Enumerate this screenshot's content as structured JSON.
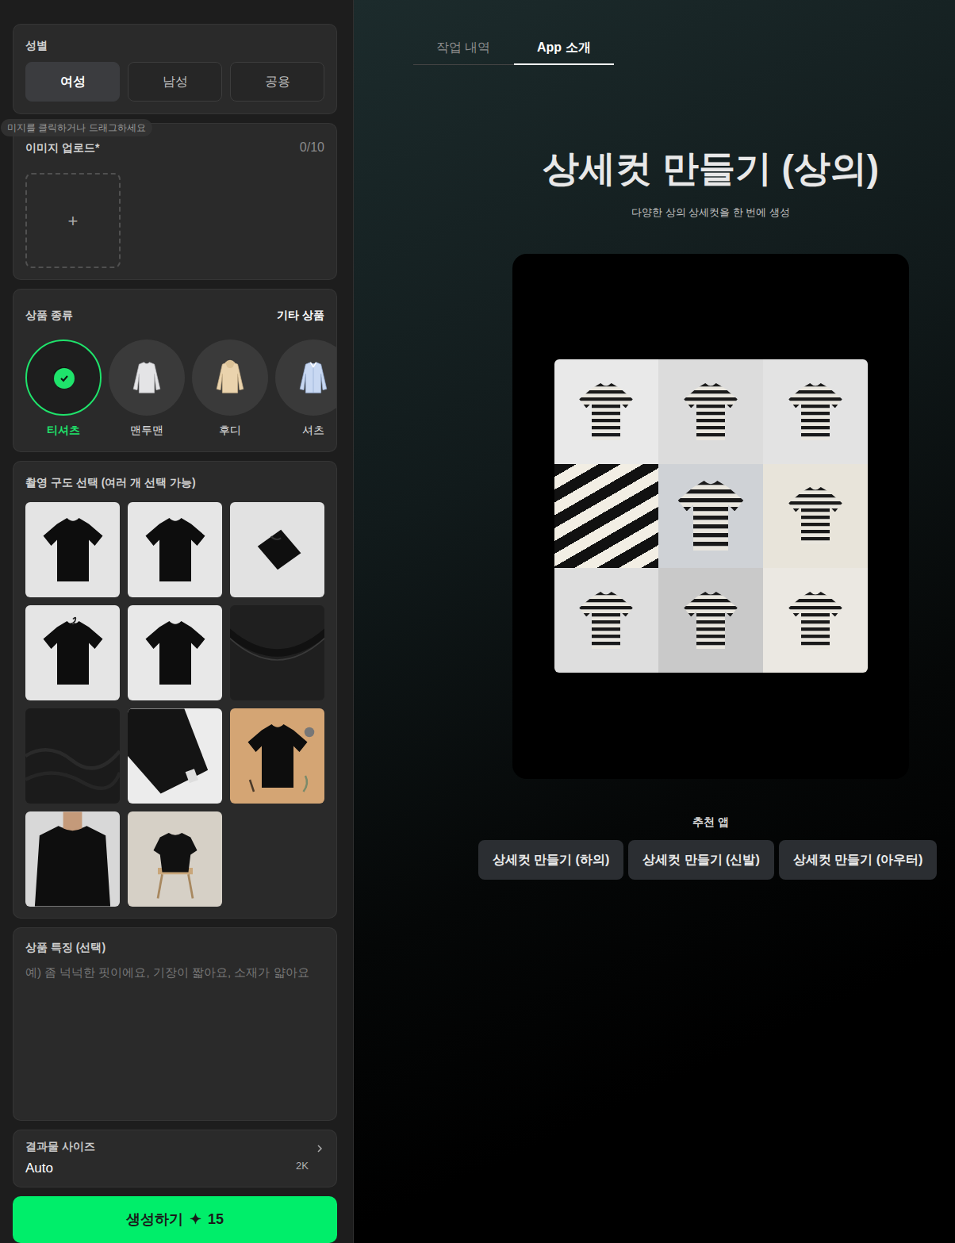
{
  "sidebar": {
    "gender": {
      "label": "성별",
      "options": [
        {
          "label": "여성",
          "selected": true
        },
        {
          "label": "남성",
          "selected": false
        },
        {
          "label": "공용",
          "selected": false
        }
      ]
    },
    "upload": {
      "label": "이미지 업로드*",
      "count": "0/10",
      "tooltip": "미지를 클릭하거나 드래그하세요",
      "add_icon": "+"
    },
    "product_type": {
      "label": "상품 종류",
      "other": "기타 상품",
      "items": [
        {
          "label": "티셔츠",
          "kind": "tshirt",
          "selected": true
        },
        {
          "label": "맨투맨",
          "kind": "sweatshirt",
          "selected": false
        },
        {
          "label": "후디",
          "kind": "hoodie",
          "selected": false
        },
        {
          "label": "셔츠",
          "kind": "shirt",
          "selected": false
        }
      ]
    },
    "compositions": {
      "label": "촬영 구도 선택 (여러 개 선택 가능)",
      "shots": [
        {
          "kind": "front"
        },
        {
          "kind": "back"
        },
        {
          "kind": "folded"
        },
        {
          "kind": "hanger"
        },
        {
          "kind": "flat"
        },
        {
          "kind": "collar"
        },
        {
          "kind": "fabric"
        },
        {
          "kind": "sleeve"
        },
        {
          "kind": "styled"
        },
        {
          "kind": "model"
        },
        {
          "kind": "chair"
        }
      ]
    },
    "features": {
      "label": "상품 특징 (선택)",
      "placeholder": "예) 좀 넉넉한 핏이에요, 기장이 짧아요, 소재가 얇아요"
    },
    "size": {
      "label": "결과물 사이즈",
      "value": "Auto",
      "resolution": "2K"
    },
    "generate": {
      "label": "생성하기",
      "icon": "✦",
      "cost": "15"
    }
  },
  "main": {
    "tabs": [
      {
        "label": "작업 내역",
        "selected": false
      },
      {
        "label": "App 소개",
        "selected": true
      }
    ],
    "title": "상세컷 만들기 (상의)",
    "subtitle": "다양한 상의 상세컷을 한 번에 생성",
    "recommended": {
      "label": "추천 앱",
      "apps": [
        "상세컷 만들기 (하의)",
        "상세컷 만들기 (신발)",
        "상세컷 만들기 (아우터)"
      ]
    }
  }
}
